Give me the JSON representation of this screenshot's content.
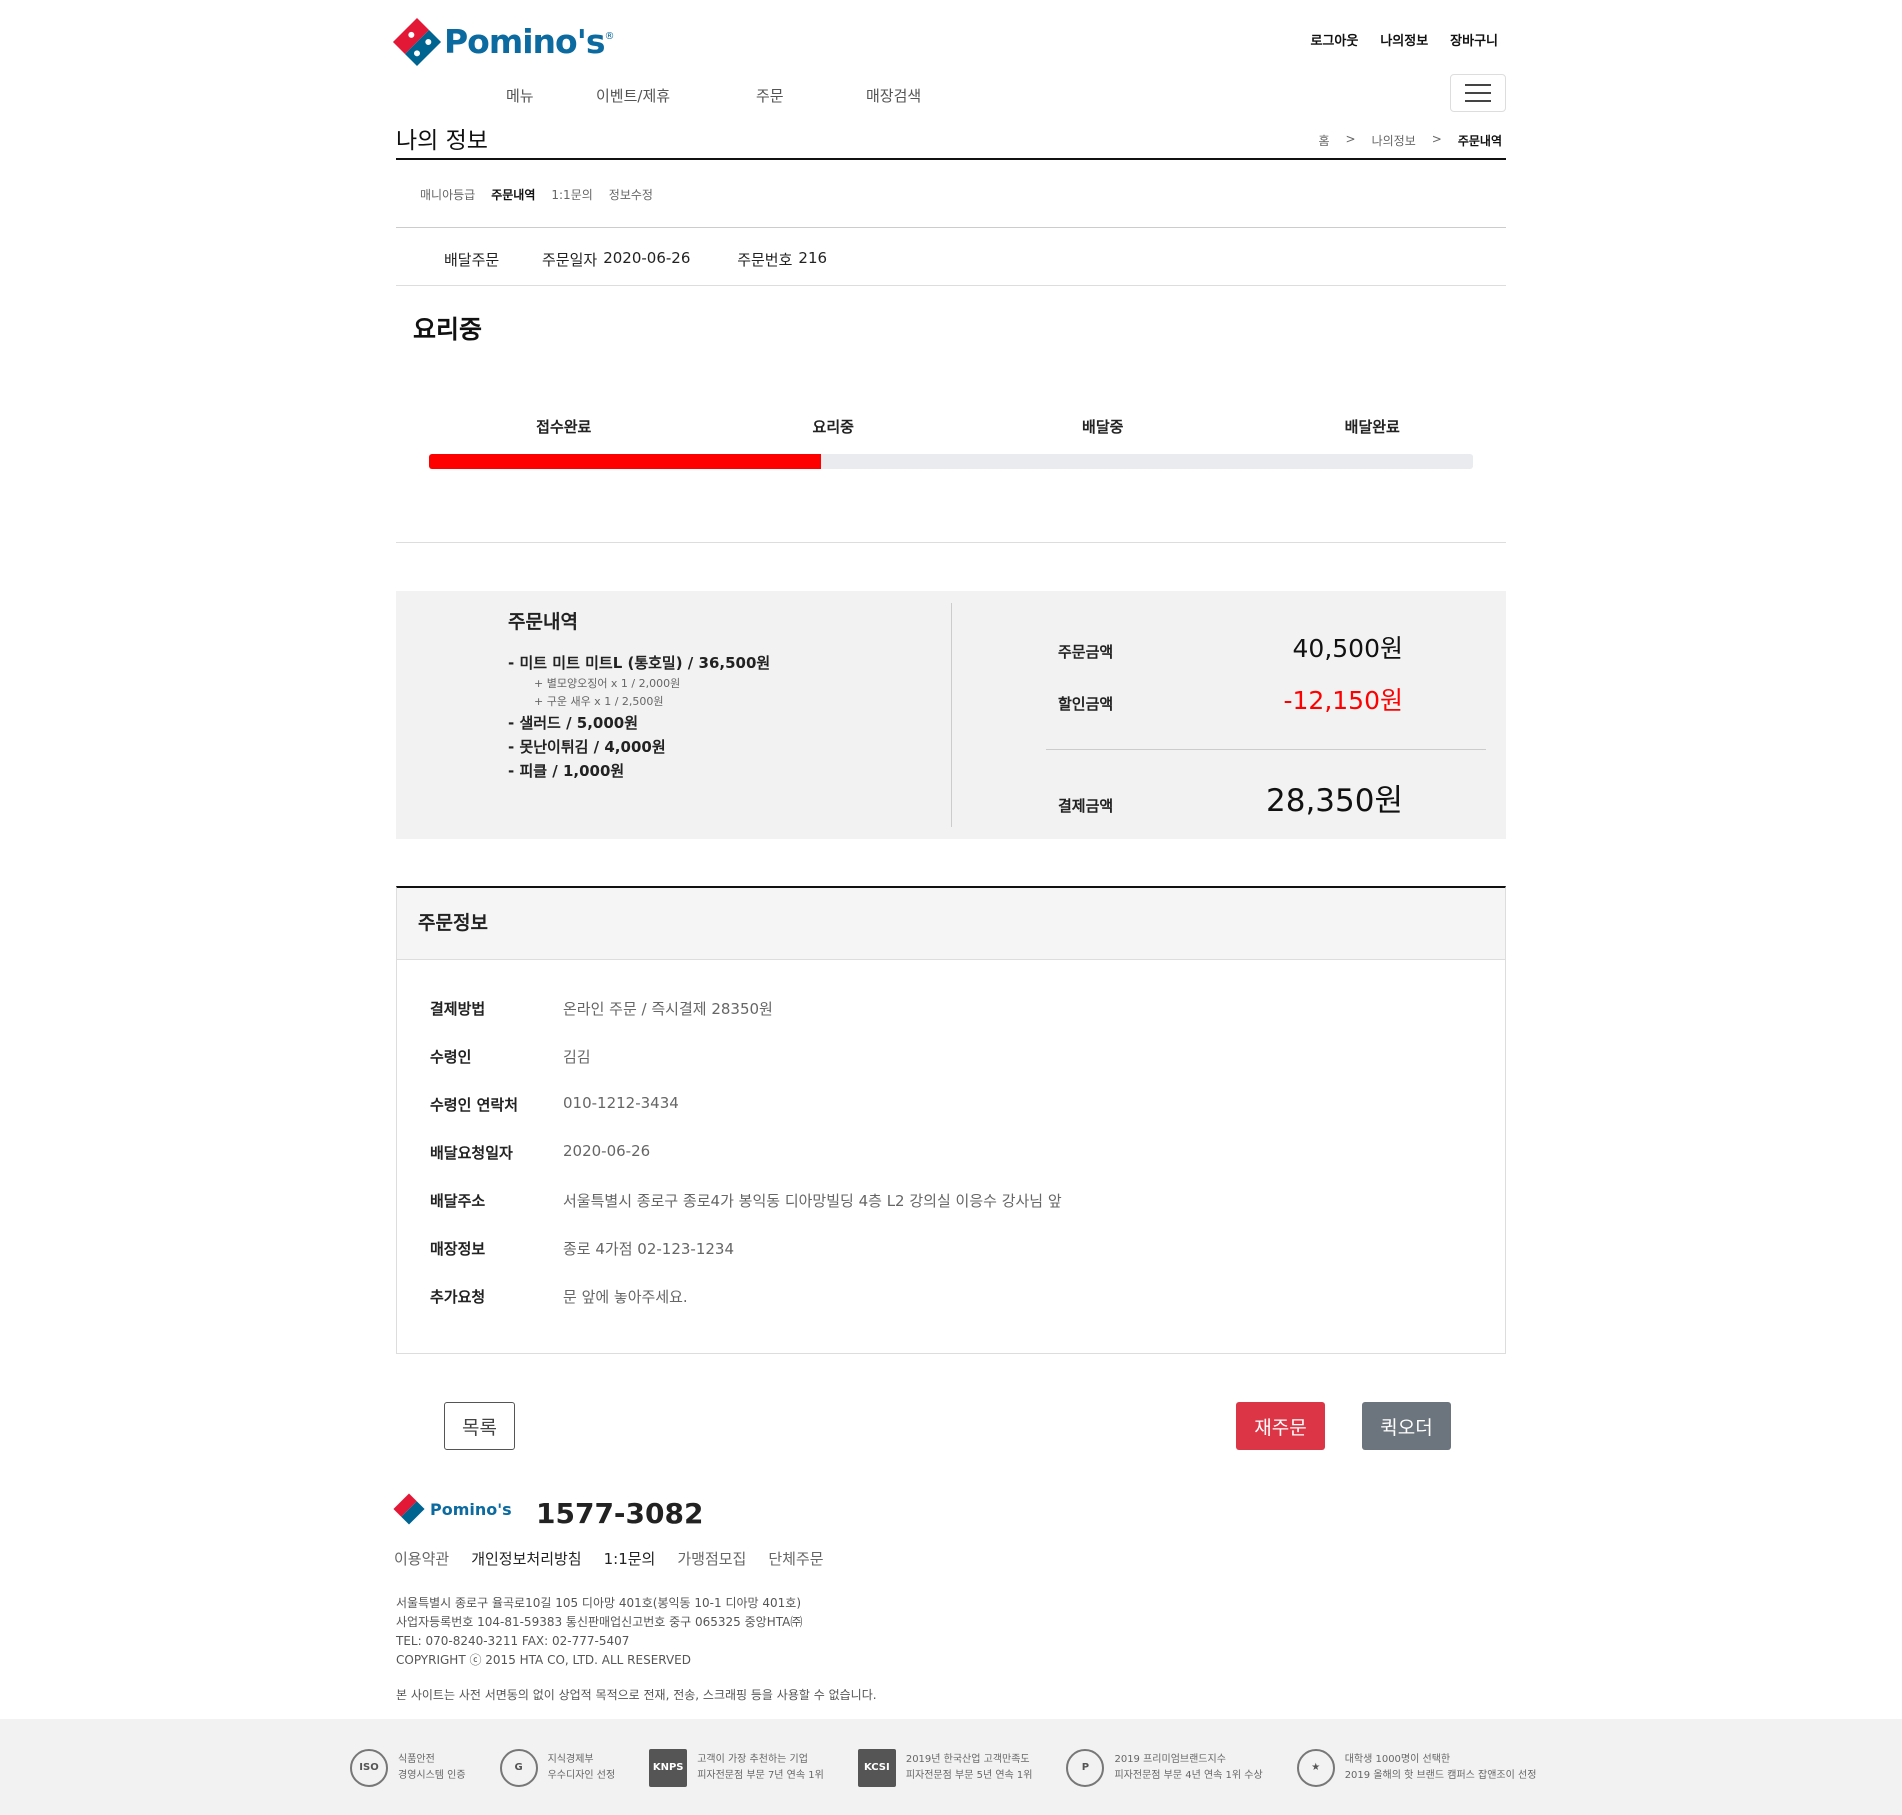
{
  "header": {
    "logo_text": "Pomino's",
    "util": [
      "로그아웃",
      "나의정보",
      "장바구니"
    ],
    "nav": [
      "메뉴",
      "이벤트/제휴",
      "주문",
      "매장검색"
    ]
  },
  "page": {
    "title": "나의 정보",
    "breadcrumb": [
      "홈",
      ">",
      "나의정보",
      ">",
      "주문내역"
    ],
    "subtabs": [
      "매니아등급",
      "주문내역",
      "1:1문의",
      "정보수정"
    ]
  },
  "order_head": {
    "type": "배달주문",
    "date_label": "주문일자",
    "date": "2020-06-26",
    "no_label": "주문번호",
    "no": "216"
  },
  "status": {
    "current": "요리중",
    "steps": [
      "접수완료",
      "요리중",
      "배달중",
      "배달완료"
    ],
    "progress": 0.375
  },
  "summary": {
    "title": "주문내역",
    "items": [
      {
        "text": "- 미트 미트 미트L (통호밀) / 36,500원",
        "options": [
          "+ 별모양오징어 x 1 / 2,000원",
          "+ 구운 새우 x 1 / 2,500원"
        ]
      },
      {
        "text": "- 샐러드 / 5,000원",
        "options": []
      },
      {
        "text": "- 못난이튀김 / 4,000원",
        "options": []
      },
      {
        "text": "- 피클 / 1,000원",
        "options": []
      }
    ],
    "order_amount_label": "주문금액",
    "order_amount": "40,500원",
    "discount_label": "할인금액",
    "discount": "-12,150원",
    "pay_label": "결제금액",
    "pay_amount": "28,350원"
  },
  "info": {
    "title": "주문정보",
    "rows": [
      {
        "k": "결제방법",
        "v": "온라인 주문 / 즉시결제 28350원"
      },
      {
        "k": "수령인",
        "v": "김김"
      },
      {
        "k": "수령인 연락처",
        "v": "010-1212-3434"
      },
      {
        "k": "배달요청일자",
        "v": "2020-06-26"
      },
      {
        "k": "배달주소",
        "v": "서울특별시 종로구 종로4가 봉익동 디아망빌딩 4층 L2 강의실 이응수 강사님 앞"
      },
      {
        "k": "매장정보",
        "v": "종로 4가점 02-123-1234"
      },
      {
        "k": "추가요청",
        "v": "문 앞에 놓아주세요."
      }
    ]
  },
  "buttons": {
    "list": "목록",
    "reorder": "재주문",
    "quick": "퀵오더"
  },
  "footer": {
    "logo_text": "Pomino's",
    "phone": "1577-3082",
    "links": [
      "이용약관",
      "개인정보처리방침",
      "1:1문의",
      "가맹점모집",
      "단체주문"
    ],
    "address": [
      "서울특별시 종로구 율곡로10길 105 디아망 401호(봉익동 10-1 디아망 401호)",
      "사업자등록번호 104-81-59383 통신판매업신고번호 중구 065325 중앙HTA㈜",
      "TEL: 070-8240-3211 FAX: 02-777-5407",
      "COPYRIGHT ⓒ 2015 HTA CO, LTD. ALL RESERVED"
    ],
    "note": "본 사이트는 사전 서면동의 없이 상업적 목적으로 전재, 전송, 스크래핑 등을 사용할 수 없습니다.",
    "certs": [
      {
        "icon": "ISO",
        "l1": "식품안전",
        "l2": "경영시스템 인증"
      },
      {
        "icon": "G",
        "l1": "지식경제부",
        "l2": "우수디자인 선정"
      },
      {
        "icon": "KNPS",
        "l1": "고객이 가장 추천하는 기업",
        "l2": "피자전문점 부문 7년 연속 1위"
      },
      {
        "icon": "KCSI",
        "l1": "2019년 한국산업 고객만족도",
        "l2": "피자전문점 부문 5년 연속 1위"
      },
      {
        "icon": "P",
        "l1": "2019 프리미엄브랜드지수",
        "l2": "피자전문점 부문 4년 연속 1위 수상"
      },
      {
        "icon": "★",
        "l1": "대학생 1000명이 선택한",
        "l2": "2019 올해의 핫 브랜드 캠퍼스 잡앤조이 선정"
      }
    ]
  }
}
